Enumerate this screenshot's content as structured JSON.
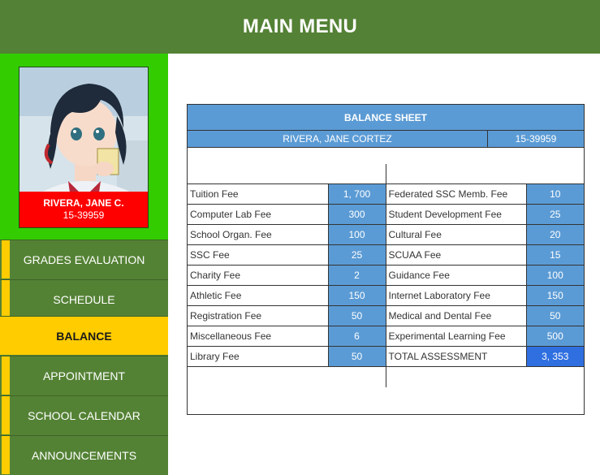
{
  "header": {
    "title": "MAIN MENU"
  },
  "profile": {
    "name": "RIVERA, JANE C.",
    "student_id": "15-39959"
  },
  "menu": [
    {
      "label": "GRADES EVALUATION",
      "active": false
    },
    {
      "label": "SCHEDULE",
      "active": false
    },
    {
      "label": "BALANCE",
      "active": true
    },
    {
      "label": "APPOINTMENT",
      "active": false
    },
    {
      "label": "SCHOOL CALENDAR",
      "active": false
    },
    {
      "label": "ANNOUNCEMENTS",
      "active": false
    }
  ],
  "balance_sheet": {
    "title": "BALANCE SHEET",
    "student_name": "RIVERA, JANE CORTEZ",
    "student_id": "15-39959",
    "rows": [
      {
        "left_label": "Tuition Fee",
        "left_value": "1, 700",
        "right_label": "Federated SSC Memb. Fee",
        "right_value": "10"
      },
      {
        "left_label": "Computer Lab Fee",
        "left_value": "300",
        "right_label": "Student Development Fee",
        "right_value": "25"
      },
      {
        "left_label": "School Organ. Fee",
        "left_value": "100",
        "right_label": "Cultural Fee",
        "right_value": "20"
      },
      {
        "left_label": "SSC Fee",
        "left_value": "25",
        "right_label": "SCUAA Fee",
        "right_value": "15"
      },
      {
        "left_label": "Charity Fee",
        "left_value": "2",
        "right_label": "Guidance Fee",
        "right_value": "100"
      },
      {
        "left_label": "Athletic Fee",
        "left_value": "150",
        "right_label": "Internet Laboratory Fee",
        "right_value": "150"
      },
      {
        "left_label": "Registration Fee",
        "left_value": "50",
        "right_label": "Medical and Dental Fee",
        "right_value": "50"
      },
      {
        "left_label": "Miscellaneous Fee",
        "left_value": "6",
        "right_label": "Experimental Learning Fee",
        "right_value": "500"
      },
      {
        "left_label": "Library Fee",
        "left_value": "50",
        "right_label": "TOTAL ASSESSMENT",
        "right_value": "3, 353"
      }
    ]
  },
  "colors": {
    "header_green": "#538135",
    "profile_green": "#33cc00",
    "menu_accent": "#ffcc00",
    "name_red": "#ff0000",
    "cell_blue": "#5b9bd5",
    "total_blue": "#2f6fe0"
  }
}
